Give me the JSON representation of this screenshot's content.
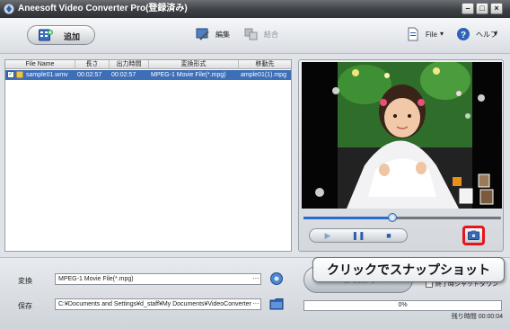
{
  "window": {
    "title": "Aneesoft Video Converter Pro(登録済み)",
    "minimize": "–",
    "maximize": "□",
    "close": "×"
  },
  "toolbar": {
    "add_label": "追加",
    "edit_label": "編集",
    "merge_label": "結合",
    "file_label": "File",
    "help_label": "ヘルプ",
    "dropdown_arrow": "▾"
  },
  "file_list": {
    "columns": [
      "File Name",
      "長さ",
      "出力時間",
      "変換形式",
      "移動先"
    ],
    "rows": [
      {
        "checked": "✓",
        "name": "sample01.wmv",
        "duration": "00:02:57",
        "output_time": "00:02:57",
        "format": "MPEG-1 Movie File(*.mpg)",
        "destination": "ample01(1).mpg"
      }
    ]
  },
  "player": {
    "play_symbol": "▶",
    "pause_symbol": "❚❚",
    "stop_symbol": "■",
    "seek_position": 0.45
  },
  "bottom": {
    "convert_label": "変換",
    "convert_value": "MPEG-1 Movie File(*.mpg)",
    "save_label": "保存",
    "save_value": "C:¥Documents and Settings¥d_staff¥My Documents¥VideoConverter",
    "browse_dots": "···",
    "start_label": "Start",
    "shutdown_label": "終了時シャットダウン",
    "progress_text": "0%",
    "progress_value": 0,
    "remaining_label": "残り時間 00:00:04"
  },
  "callout": {
    "text": "クリックでスナップショット"
  }
}
